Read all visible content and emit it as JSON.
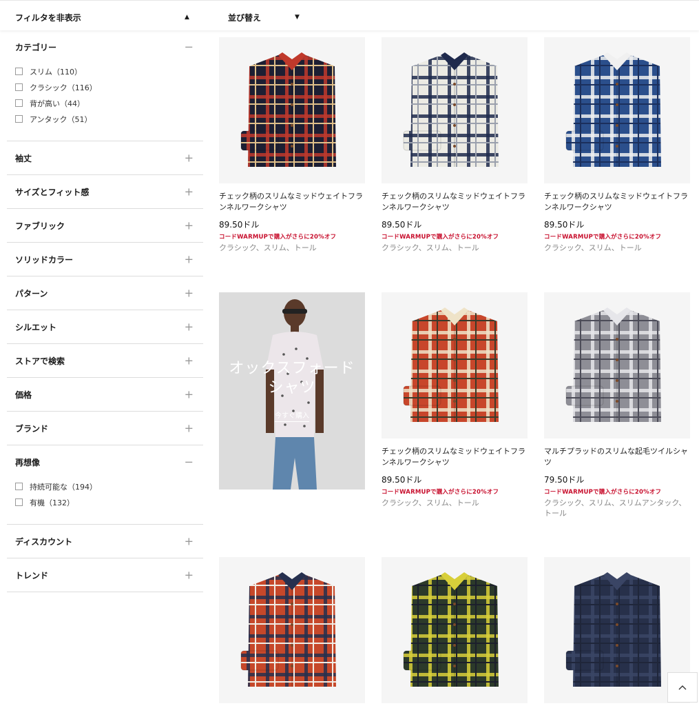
{
  "topbar": {
    "filter_toggle": "フィルタを非表示",
    "sort_label": "並び替え",
    "filter_caret": "▲",
    "sort_caret": "▼"
  },
  "sidebar": {
    "sections": [
      {
        "label": "カテゴリー",
        "expanded": true,
        "icon": "minus-icon",
        "options": [
          "スリム（110）",
          "クラシック（116）",
          "背が高い（44）",
          "アンタック（51）"
        ]
      },
      {
        "label": "袖丈",
        "expanded": false,
        "icon": "plus-icon"
      },
      {
        "label": "サイズとフィット感",
        "expanded": false,
        "icon": "plus-icon"
      },
      {
        "label": "ファブリック",
        "expanded": false,
        "icon": "plus-icon"
      },
      {
        "label": "ソリッドカラー",
        "expanded": false,
        "icon": "plus-icon"
      },
      {
        "label": "パターン",
        "expanded": false,
        "icon": "plus-icon"
      },
      {
        "label": "シルエット",
        "expanded": false,
        "icon": "plus-icon"
      },
      {
        "label": "ストアで検索",
        "expanded": false,
        "icon": "plus-icon"
      },
      {
        "label": "価格",
        "expanded": false,
        "icon": "plus-icon"
      },
      {
        "label": "ブランド",
        "expanded": false,
        "icon": "plus-icon"
      },
      {
        "label": "再想像",
        "expanded": true,
        "icon": "minus-icon",
        "options": [
          "持続可能な（194）",
          "有機（132）"
        ]
      },
      {
        "label": "ディスカウント",
        "expanded": false,
        "icon": "plus-icon"
      },
      {
        "label": "トレンド",
        "expanded": false,
        "icon": "plus-icon"
      }
    ]
  },
  "products": [
    {
      "title": "チェック柄のスリムなミッドウェイトフランネルワークシャツ",
      "price": "89.50ドル",
      "promo": "コードWARMUPで購入がさらに20%オフ",
      "fits": "クラシック、スリム、トール",
      "colors": [
        "#1d1f33",
        "#c0392b",
        "#e0c08a"
      ]
    },
    {
      "title": "チェック柄のスリムなミッドウェイトフランネルワークシャツ",
      "price": "89.50ドル",
      "promo": "コードWARMUPで購入がさらに20%オフ",
      "fits": "クラシック、スリム、トール",
      "colors": [
        "#ecebe4",
        "#1f2a4d",
        "#9aa0ad"
      ]
    },
    {
      "title": "チェック柄のスリムなミッドウェイトフランネルワークシャツ",
      "price": "89.50ドル",
      "promo": "コードWARMUPで購入がさらに20%オフ",
      "fits": "クラシック、スリム、トール",
      "colors": [
        "#2b4f8c",
        "#f0f0f0",
        "#1b2f5c"
      ]
    },
    {
      "title": "チェック柄のスリムなミッドウェイトフランネルワークシャツ",
      "price": "89.50ドル",
      "promo": "コードWARMUPで購入がさらに20%オフ",
      "fits": "クラシック、スリム、トール",
      "colors": [
        "#c8462b",
        "#efe3c8",
        "#3b3b2a"
      ]
    },
    {
      "title": "マルチプラッドのスリムな起毛ツイルシャツ",
      "price": "79.50ドル",
      "promo": "コードWARMUPで購入がさらに20%オフ",
      "fits": "クラシック、スリム、スリムアンタック、トール",
      "colors": [
        "#8e8e96",
        "#e6e6ea",
        "#4c4c58"
      ]
    },
    {
      "title": "",
      "price": "",
      "promo": "",
      "fits": "",
      "colors": [
        "#c6482a",
        "#26304f",
        "#f1ece4"
      ]
    },
    {
      "title": "",
      "price": "",
      "promo": "",
      "fits": "",
      "colors": [
        "#2c3a2a",
        "#d8cf3a",
        "#1c1f2c"
      ]
    },
    {
      "title": "",
      "price": "",
      "promo": "",
      "fits": "",
      "colors": [
        "#27304a",
        "#3a4565",
        "#1f263a"
      ]
    }
  ],
  "promo_tile": {
    "title": "オックスフォード\nシャツ",
    "link": "今すぐ購入"
  },
  "scroll_top_icon": "chevron-up-icon"
}
